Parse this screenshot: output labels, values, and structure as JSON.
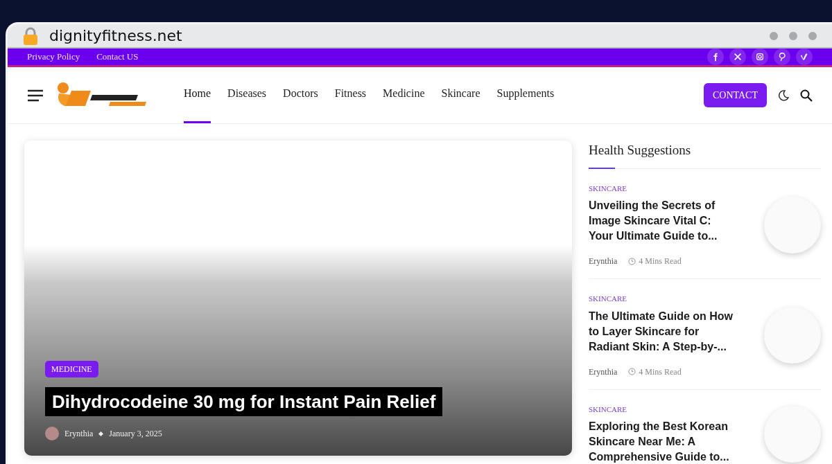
{
  "browser": {
    "url": "dignityfitness.net",
    "secure": true
  },
  "topbar": {
    "links": [
      "Privacy Policy",
      "Contact US"
    ],
    "social": [
      {
        "kind": "facebook"
      },
      {
        "kind": "x"
      },
      {
        "kind": "instagram"
      },
      {
        "kind": "pinterest"
      },
      {
        "kind": "vimeo"
      }
    ]
  },
  "header": {
    "nav": [
      {
        "label": "Home",
        "selected": true
      },
      {
        "label": "Diseases",
        "selected": false
      },
      {
        "label": "Doctors",
        "selected": false
      },
      {
        "label": "Fitness",
        "selected": false
      },
      {
        "label": "Medicine",
        "selected": false
      },
      {
        "label": "Skincare",
        "selected": false
      },
      {
        "label": "Supplements",
        "selected": false
      }
    ],
    "contact_button": "CONTACT"
  },
  "hero": {
    "category": "MEDICINE",
    "title": "Dihydrocodeine 30 mg for Instant Pain Relief",
    "author": "Erynthia",
    "date": "January 3, 2025"
  },
  "sidebar": {
    "title": "Health Suggestions",
    "articles": [
      {
        "category": "SKINCARE",
        "title": "Unveiling the Secrets of Image Skincare Vital C: Your Ultimate Guide to...",
        "author": "Erynthia",
        "read_time": "4 Mins Read"
      },
      {
        "category": "SKINCARE",
        "title": "The Ultimate Guide on How to Layer Skincare for Radiant Skin: A Step-by-...",
        "author": "Erynthia",
        "read_time": "4 Mins Read"
      },
      {
        "category": "SKINCARE",
        "title": "Exploring the Best Korean Skincare Near Me: A Comprehensive Guide to..."
      }
    ]
  }
}
